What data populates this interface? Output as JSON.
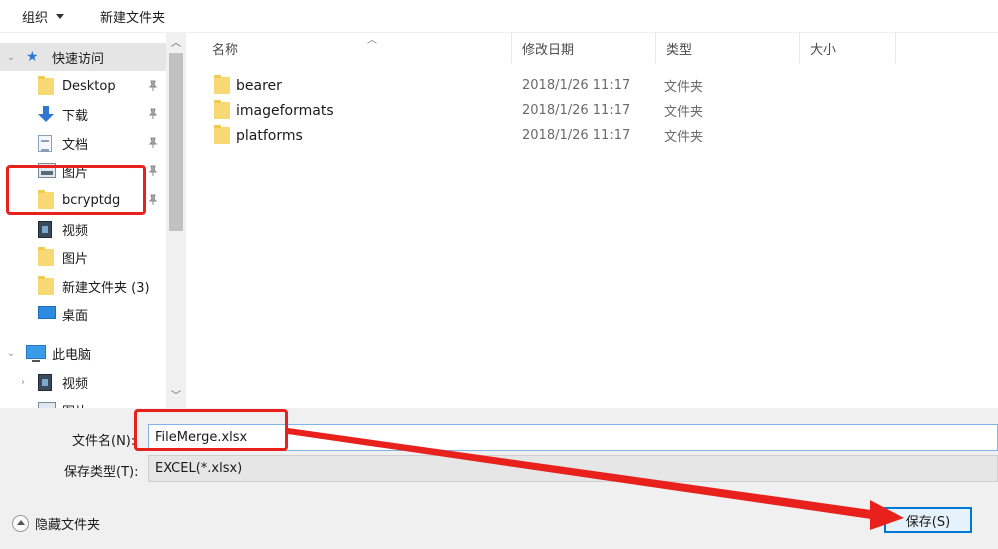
{
  "toolbar": {
    "organize": "组织",
    "new_folder": "新建文件夹"
  },
  "nav": {
    "quick_access": "快速访问",
    "items": [
      {
        "label": "Desktop",
        "icon": "folder-icon",
        "pinned": true
      },
      {
        "label": "下载",
        "icon": "download-icon",
        "pinned": true
      },
      {
        "label": "文档",
        "icon": "document-icon",
        "pinned": true
      },
      {
        "label": "图片",
        "icon": "picture-icon",
        "pinned": true
      },
      {
        "label": "bcryptdg",
        "icon": "folder-icon",
        "pinned": true
      },
      {
        "label": "视频",
        "icon": "video-icon",
        "pinned": false
      },
      {
        "label": "图片",
        "icon": "folder-icon",
        "pinned": false
      },
      {
        "label": "新建文件夹 (3)",
        "icon": "folder-icon",
        "pinned": false
      },
      {
        "label": "桌面",
        "icon": "desktop-icon",
        "pinned": false
      }
    ],
    "this_pc": "此电脑",
    "pc_items": [
      {
        "label": "视频",
        "icon": "video-icon"
      },
      {
        "label": "图片",
        "icon": "picture-icon"
      }
    ]
  },
  "columns": {
    "name": "名称",
    "date": "修改日期",
    "type": "类型",
    "size": "大小"
  },
  "files": [
    {
      "name": "bearer",
      "date": "2018/1/26 11:17",
      "type": "文件夹"
    },
    {
      "name": "imageformats",
      "date": "2018/1/26 11:17",
      "type": "文件夹"
    },
    {
      "name": "platforms",
      "date": "2018/1/26 11:17",
      "type": "文件夹"
    }
  ],
  "form": {
    "filename_label": "文件名(N):",
    "filename_value": "FileMerge.xlsx",
    "filetype_label": "保存类型(T):",
    "filetype_value": "EXCEL(*.xlsx)"
  },
  "footer": {
    "hide_folders": "隐藏文件夹",
    "save": "保存(S)"
  },
  "colors": {
    "annotation_red": "#e8211d",
    "accent_blue": "#0078d7",
    "folder_yellow": "#f8d775"
  }
}
